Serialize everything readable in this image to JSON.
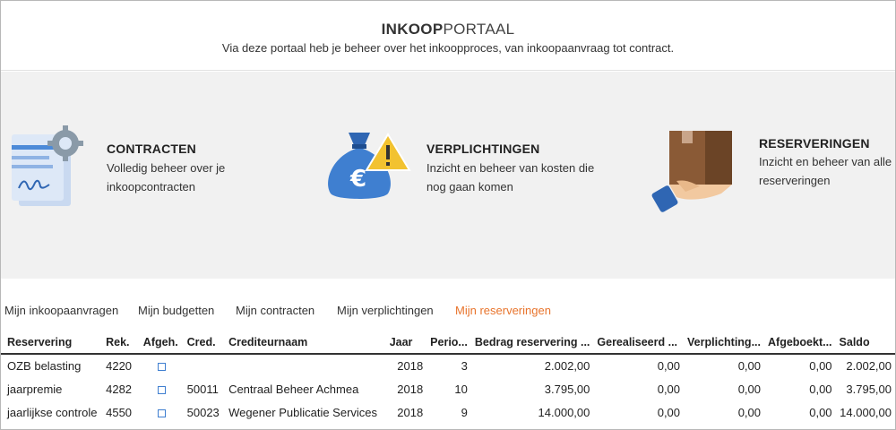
{
  "header": {
    "title_bold": "INKOOP",
    "title_light": "PORTAAL",
    "subtitle": "Via deze portaal heb je beheer over het inkoopproces, van inkoopaanvraag tot contract."
  },
  "tiles": [
    {
      "title": "CONTRACTEN",
      "desc_line1": "Volledig beheer over je",
      "desc_line2": "inkoopcontracten",
      "icon": "contract-gear-icon"
    },
    {
      "title": "VERPLICHTINGEN",
      "desc_line1": "Inzicht en beheer van kosten die",
      "desc_line2": "nog gaan komen",
      "icon": "money-bag-warning-icon"
    },
    {
      "title": "RESERVERINGEN",
      "desc_line1": "Inzicht en beheer van alle",
      "desc_line2": "reserveringen",
      "icon": "hand-package-icon"
    }
  ],
  "tabs": [
    {
      "label": "Mijn inkoopaanvragen",
      "active": false
    },
    {
      "label": "Mijn budgetten",
      "active": false
    },
    {
      "label": "Mijn contracten",
      "active": false
    },
    {
      "label": "Mijn verplichtingen",
      "active": false
    },
    {
      "label": "Mijn reserveringen",
      "active": true
    }
  ],
  "colors": {
    "active_tab": "#e8742c",
    "icon_blue": "#3f7fd0",
    "warning_yellow": "#f2c230"
  },
  "table": {
    "columns": [
      "Reservering",
      "Rek.",
      "Afgeh.",
      "Cred.",
      "Crediteurnaam",
      "Jaar",
      "Perio...",
      "Bedrag reservering ...",
      "Gerealiseerd ...",
      "Verplichting...",
      "Afgeboekt...",
      "Saldo"
    ],
    "rows": [
      {
        "reservering": "OZB belasting",
        "rek": "4220",
        "cred": "",
        "crediteurnaam": "",
        "jaar": "2018",
        "periode": "3",
        "bedrag": "2.002,00",
        "gerealiseerd": "0,00",
        "verplichting": "0,00",
        "afgeboekt": "0,00",
        "saldo": "2.002,00"
      },
      {
        "reservering": "jaarpremie",
        "rek": "4282",
        "cred": "50011",
        "crediteurnaam": "Centraal Beheer Achmea",
        "jaar": "2018",
        "periode": "10",
        "bedrag": "3.795,00",
        "gerealiseerd": "0,00",
        "verplichting": "0,00",
        "afgeboekt": "0,00",
        "saldo": "3.795,00"
      },
      {
        "reservering": "jaarlijkse controle",
        "rek": "4550",
        "cred": "50023",
        "crediteurnaam": "Wegener Publicatie Services",
        "jaar": "2018",
        "periode": "9",
        "bedrag": "14.000,00",
        "gerealiseerd": "0,00",
        "verplichting": "0,00",
        "afgeboekt": "0,00",
        "saldo": "14.000,00"
      }
    ]
  }
}
